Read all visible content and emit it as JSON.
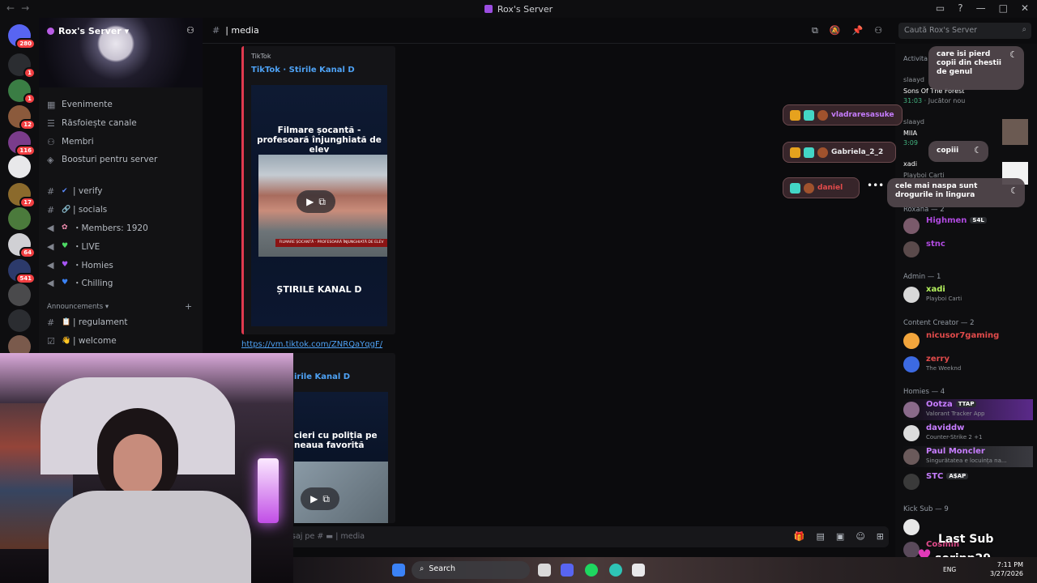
{
  "window": {
    "title": "Rox's Server",
    "nav_back": "←",
    "nav_forward": "→"
  },
  "server_rail": {
    "badges": [
      "280",
      "1",
      "1",
      "12",
      "116",
      "17",
      "64",
      "541"
    ]
  },
  "sidebar": {
    "server_name": "Rox's Server",
    "items": [
      {
        "icon": "calendar-icon",
        "label": "Evenimente"
      },
      {
        "icon": "channels-icon",
        "label": "Răsfoiește canale"
      },
      {
        "icon": "members-icon",
        "label": "Membri"
      },
      {
        "icon": "boost-icon",
        "label": "Boosturi pentru server"
      }
    ],
    "channels": [
      {
        "type": "text",
        "emoji": "✔",
        "label": "| verify"
      },
      {
        "type": "text",
        "emoji": "🔗",
        "label": "| socials"
      },
      {
        "type": "voice",
        "emoji": "✿",
        "label": "・Members: 1920"
      },
      {
        "type": "voice",
        "emoji": "♥",
        "label": "・LIVE"
      },
      {
        "type": "voice",
        "emoji": "♥",
        "label": "・Homies"
      },
      {
        "type": "voice",
        "emoji": "♥",
        "label": "・Chilling"
      }
    ],
    "category": "Announcements",
    "category_channels": [
      {
        "emoji": "📋",
        "label": "| regulament"
      },
      {
        "emoji": "👋",
        "label": "| welcome"
      }
    ]
  },
  "header": {
    "channel": "| media",
    "search_placeholder": "Caută Rox's Server"
  },
  "embeds": [
    {
      "provider": "TikTok",
      "title": "TikTok · Stirile Kanal D",
      "video_headline": "Filmare șocantă - profesoară înjunghiată de elev",
      "ticker": "FILMARE ȘOCANTĂ - PROFESOARĂ ÎNJUNGHIATĂ DE ELEV",
      "brand": "ȘTIRILE KANAL D"
    },
    {
      "title": "irile Kanal D",
      "video_headline": "cieri cu poliția pe neaua favorită"
    }
  ],
  "link": "https://vm.tiktok.com/ZNRQaYqgF/",
  "composer": {
    "placeholder": "saj pe # ▬ | media"
  },
  "members": {
    "activity_header": "Activita",
    "activities": [
      {
        "user": "slaayd",
        "game": "Sons Of The Forest",
        "meta": "31:03",
        "tag": "Jucător nou"
      },
      {
        "user": "slaayd",
        "game": "MIIA",
        "meta": "3:09"
      },
      {
        "user": "xadi",
        "game": "Playboi Carti"
      }
    ],
    "groups": [
      {
        "name": "Roxana — 2",
        "rows": [
          {
            "name": "Highmen",
            "tag": "S4L",
            "color": "#b04ae0",
            "status": ""
          },
          {
            "name": "stnc",
            "color": "#b04ae0",
            "status": ""
          }
        ]
      },
      {
        "name": "Admin — 1",
        "rows": [
          {
            "name": "xadi",
            "color": "#b5f25e",
            "status": "Playboi Carti"
          }
        ]
      },
      {
        "name": "Content Creator — 2",
        "rows": [
          {
            "name": "nicusor7gaming",
            "color": "#e24b4b",
            "status": ""
          },
          {
            "name": "zerry",
            "color": "#e24b4b",
            "status": "The Weeknd"
          }
        ]
      },
      {
        "name": "Homies — 4",
        "rows": [
          {
            "name": "Ootza",
            "tag": "TTAP",
            "color": "#c77dff",
            "status": "Valorant Tracker App"
          },
          {
            "name": "daviddw",
            "color": "#c77dff",
            "status": "Counter-Strike 2 +1"
          },
          {
            "name": "Paul Moncler",
            "color": "#c77dff",
            "status": "Singurătatea e locuința na..."
          },
          {
            "name": "STC",
            "tag": "A$AP",
            "color": "#c77dff",
            "status": ""
          }
        ]
      },
      {
        "name": "Kick Sub — 9",
        "rows": [
          {
            "name": "Cosmin",
            "color": "#e24b8c",
            "status": ""
          }
        ]
      }
    ]
  },
  "overlay": {
    "chips": [
      "vladraresasuke",
      "Gabriela_2_2",
      "daniel"
    ],
    "bubbles": [
      "care isi pierd copii din chestii de genul",
      "copiii",
      "cele mai naspa sunt drogurile in lingura"
    ],
    "last_sub_label": "Last Sub",
    "last_sub_name": "sorinp29"
  },
  "taskbar": {
    "search": "Search",
    "lang": "ENG",
    "time": "7:11 PM",
    "date": "3/27/2026"
  },
  "colors": {
    "accent": "#4ea2f5",
    "embed_border": "#e03a4f",
    "badge": "#f23f42"
  }
}
